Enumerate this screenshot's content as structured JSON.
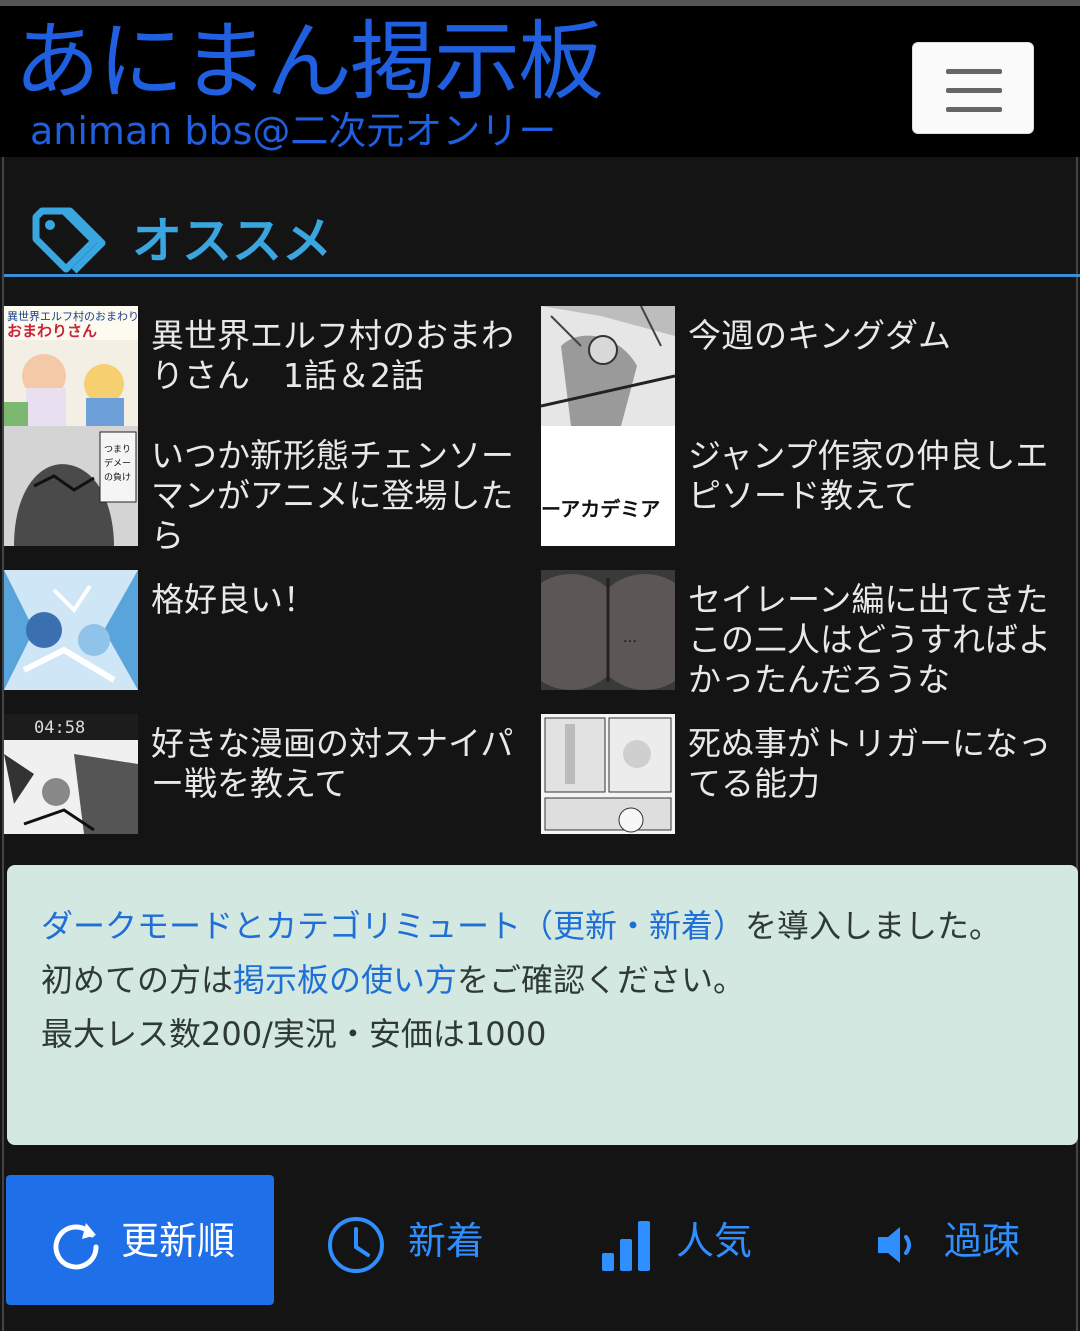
{
  "header": {
    "logo_main": "あにまん掲示板",
    "logo_sub": "animan bbs@二次元オンリー",
    "menu_icon": "hamburger-menu-icon"
  },
  "section": {
    "title": "オススメ",
    "icon": "tag-icon",
    "accent": "#3aa6e0"
  },
  "recommended": [
    {
      "title": "異世界エルフ村のおまわりさん　1話＆2話",
      "thumb_text": "異世界エルフ村のおまわりさん"
    },
    {
      "title": "今週のキングダム",
      "thumb_text": ""
    },
    {
      "title": "いつか新形態チェンソーマンがアニメに登場したら",
      "thumb_text": "つまりデメーの負けって事だぜ!!"
    },
    {
      "title": "ジャンプ作家の仲良しエピソード教えて",
      "thumb_text": "ーアカデミア"
    },
    {
      "title": "格好良い！",
      "thumb_text": ""
    },
    {
      "title": "セイレーン編に出てきたこの二人はどうすればよかったんだろうな",
      "thumb_text": "…"
    },
    {
      "title": "好きな漫画の対スナイパー戦を教えて",
      "thumb_text": "04:58"
    },
    {
      "title": "死ぬ事がトリガーになってる能力",
      "thumb_text": ""
    }
  ],
  "notice": {
    "line1_link": "ダークモードとカテゴリミュート（更新・新着）",
    "line1_rest": "を導入しました。",
    "line2_pre": "初めての方は",
    "line2_link": "掲示板の使い方",
    "line2_post": "をご確認ください。",
    "line3": "最大レス数200/実況・安価は1000"
  },
  "tabs": [
    {
      "label": "更新順",
      "icon": "refresh-icon",
      "active": true
    },
    {
      "label": "新着",
      "icon": "clock-icon",
      "active": false
    },
    {
      "label": "人気",
      "icon": "bar-chart-icon",
      "active": false
    },
    {
      "label": "過疎",
      "icon": "speaker-icon",
      "active": false
    }
  ],
  "colors": {
    "logo": "#1f5fe0",
    "active_tab": "#1f6fe8",
    "tab_text": "#2f8fff",
    "notice_bg": "#d2e8e0",
    "link": "#1f6fd6"
  }
}
